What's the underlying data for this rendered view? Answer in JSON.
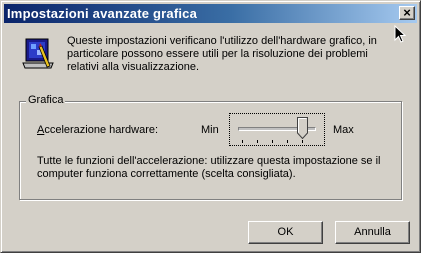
{
  "window": {
    "title": "Impostazioni avanzate grafica",
    "close_label": "×"
  },
  "info": {
    "icon": "monitor-settings-icon",
    "description": "Queste impostazioni verificano l'utilizzo dell'hardware grafico, in particolare possono essere utili per la risoluzione dei problemi relativi alla visualizzazione."
  },
  "group": {
    "label": "Grafica",
    "accel_label_prefix": "A",
    "accel_label_rest": "ccelerazione hardware:",
    "min_label": "Min",
    "max_label": "Max",
    "slider_value": 5,
    "slider_max": 5,
    "description": "Tutte le funzioni dell'accelerazione: utilizzare questa impostazione se il computer funziona correttamente (scelta consigliata)."
  },
  "buttons": {
    "ok": "OK",
    "cancel": "Annulla"
  },
  "colors": {
    "face": "#d4d0c8",
    "title_start": "#0a246a",
    "title_end": "#a6caf0"
  }
}
